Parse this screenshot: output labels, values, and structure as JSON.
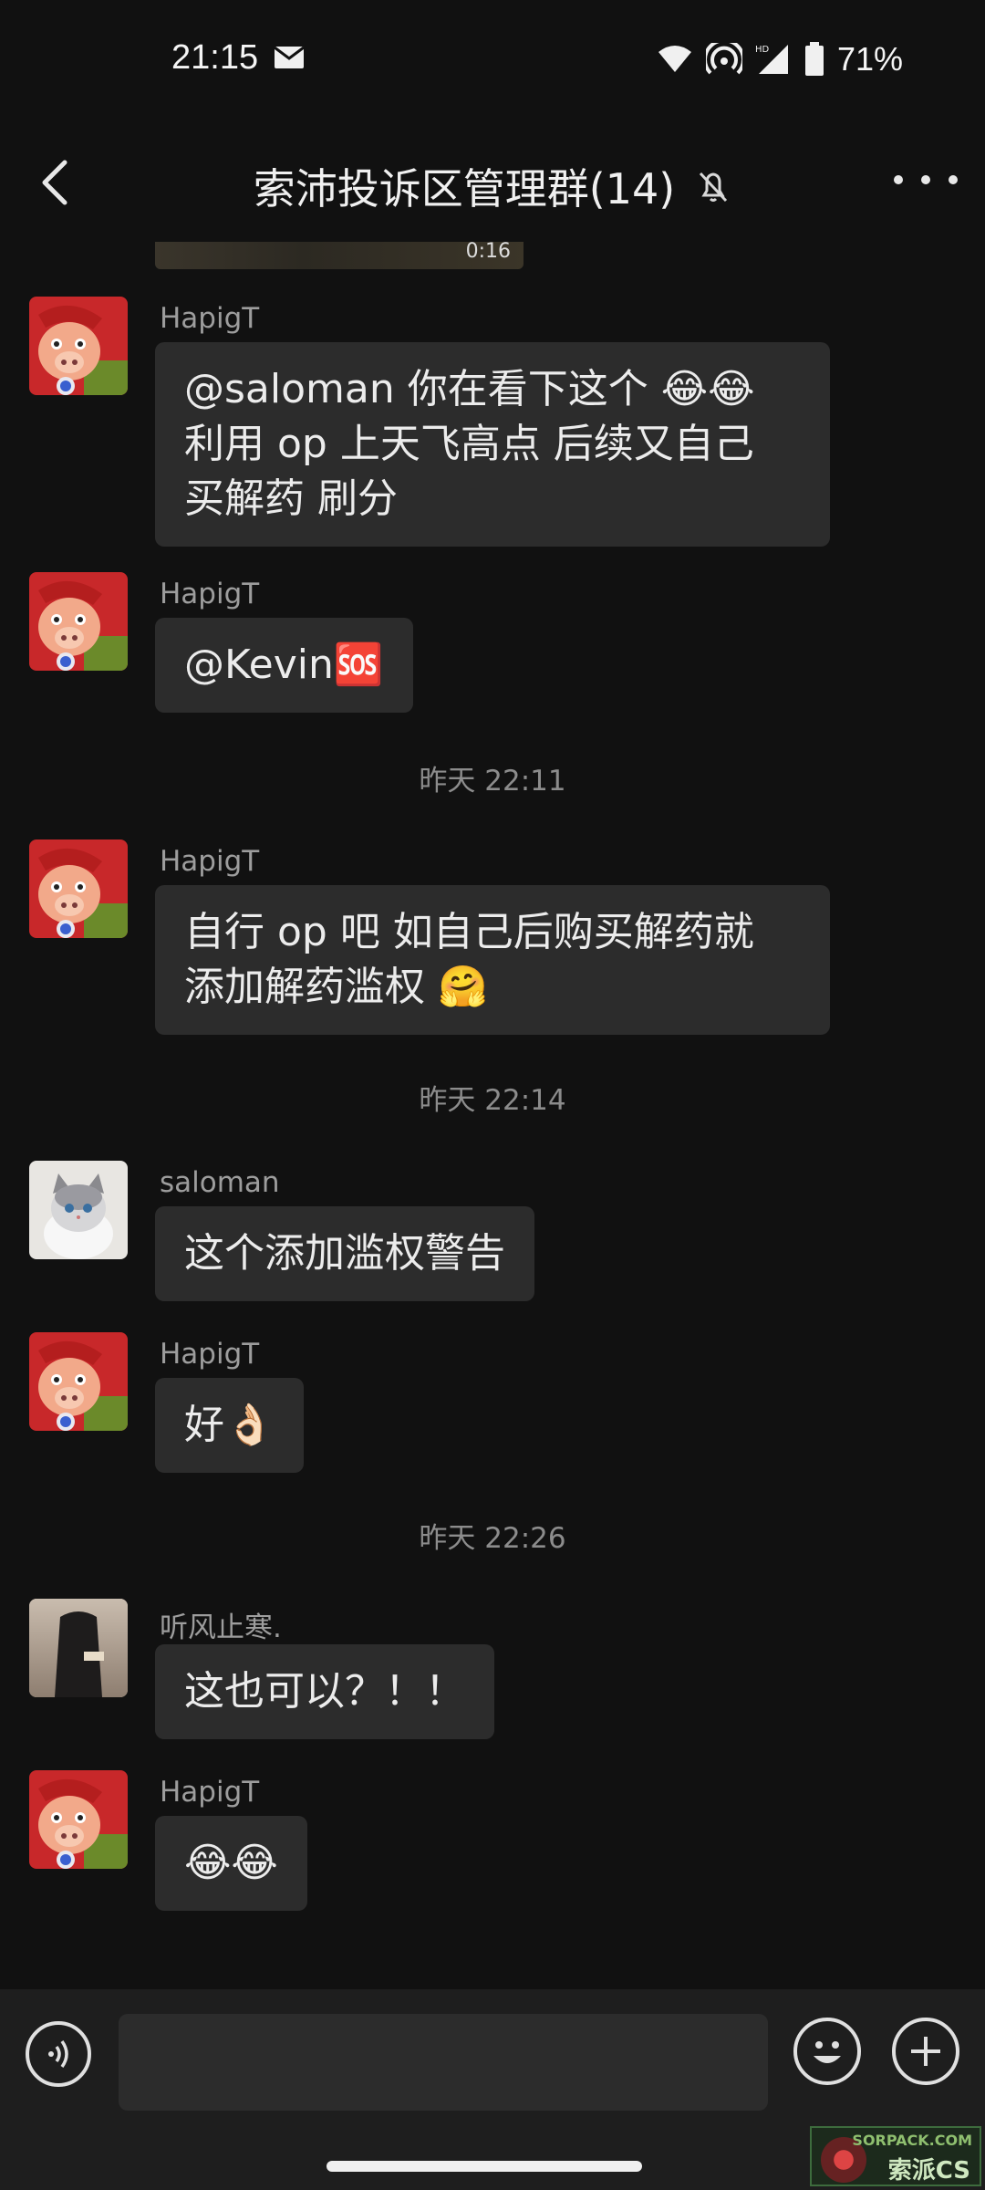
{
  "status_bar": {
    "time": "21:15",
    "battery_percent": "71%",
    "icons": [
      "mail-icon",
      "wifi-icon",
      "hotspot-icon",
      "signal-hd-icon",
      "battery-icon"
    ]
  },
  "header": {
    "title": "索沛投诉区管理群(14)",
    "muted": true
  },
  "image_strip_text": "0:16",
  "messages": [
    {
      "sender": "HapigT",
      "lines": [
        "@saloman  你在看下这个 😂😂",
        "利用 op 上天飞高点  后续又自己",
        "买解药 刷分"
      ]
    },
    {
      "sender": "HapigT",
      "lines": [
        "@Kevin🆘"
      ]
    },
    {
      "sender": "HapigT",
      "lines": [
        "自行 op 吧  如自己后购买解药就",
        "添加解药滥权 🤗"
      ]
    },
    {
      "sender": "saloman",
      "lines": [
        "这个添加滥权警告"
      ]
    },
    {
      "sender": "HapigT",
      "lines": [
        "好👌🏻"
      ]
    },
    {
      "sender": "听风止寒.",
      "lines": [
        "这也可以？！！"
      ]
    },
    {
      "sender": "HapigT",
      "lines": [
        "😂😂"
      ]
    }
  ],
  "timestamps": [
    "昨天 22:11",
    "昨天 22:14",
    "昨天 22:26"
  ],
  "watermark": {
    "top": "SORPACK.COM",
    "bottom": "索派CS"
  },
  "colors": {
    "background": "#111111",
    "bubble": "#2c2c2c",
    "input_bar": "#1e1e1e"
  }
}
